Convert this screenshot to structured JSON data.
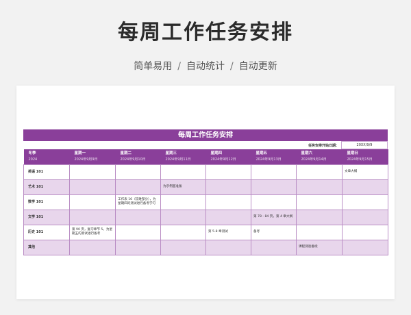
{
  "hero": {
    "title": "每周工作任务安排",
    "features": [
      "简单易用",
      "自动统计",
      "自动更新"
    ],
    "separator": "/"
  },
  "sheet": {
    "title": "每周工作任务安排",
    "start_label": "任务安排开始日期:",
    "start_value": "20XX/9/9",
    "columns": [
      {
        "day": "冬季",
        "date": "2024"
      },
      {
        "day": "星期一",
        "date": "2024年9月9日"
      },
      {
        "day": "星期二",
        "date": "2024年9月10日"
      },
      {
        "day": "星期三",
        "date": "2024年9月11日"
      },
      {
        "day": "星期四",
        "date": "2024年9月12日"
      },
      {
        "day": "星期五",
        "date": "2024年9月13日"
      },
      {
        "day": "星期六",
        "date": "2024年9月14日"
      },
      {
        "day": "星期日",
        "date": "2024年9月15日"
      }
    ],
    "rows": [
      {
        "subject": "英语 101",
        "cells": [
          "",
          "",
          "",
          "",
          "",
          "",
          "文章大纲"
        ]
      },
      {
        "subject": "艺术 101",
        "cells": [
          "",
          "",
          "为示例画准备",
          "",
          "",
          "",
          ""
        ]
      },
      {
        "subject": "数学 101",
        "cells": [
          "",
          "工作表 16（较难部分），为星期四的测试进行备考学习",
          "",
          "",
          "",
          "",
          ""
        ]
      },
      {
        "subject": "文学 101",
        "cells": [
          "",
          "",
          "",
          "",
          "第 78 - 84 页，第 4 章大纲",
          "",
          ""
        ]
      },
      {
        "subject": "历史 101",
        "cells": [
          "第 90 页，复习章节 5，为星期五的测试进行备考",
          "",
          "",
          "第 5-8 章测试",
          "备考",
          "",
          ""
        ]
      },
      {
        "subject": "其他",
        "cells": [
          "",
          "",
          "",
          "",
          "",
          "课程测验备续",
          ""
        ]
      }
    ]
  },
  "colors": {
    "accent": "#8a3f9a",
    "row_alt": "#e8d6ec",
    "border": "#b98cc4"
  }
}
